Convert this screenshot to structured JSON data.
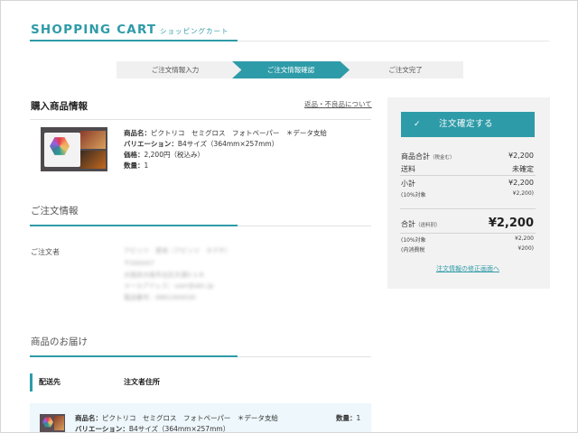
{
  "header": {
    "title": "SHOPPING CART",
    "subtitle": "ショッピングカート"
  },
  "steps": [
    "ご注文情報入力",
    "ご注文情報確認",
    "ご注文完了"
  ],
  "purchase": {
    "title": "購入商品情報",
    "returns_link": "返品・不良品について",
    "product": {
      "name_label": "商品名：",
      "name_value": "ピクトリコ　セミグロス　フォトペーパー　＊データ支給",
      "variation_label": "バリエーション：",
      "variation_value": "B4サイズ（364mm×257mm）",
      "price_label": "価格：",
      "price_value": "2,200円（税込み）",
      "qty_label": "数量：",
      "qty_value": "1"
    }
  },
  "order_info": {
    "title": "ご注文情報",
    "orderer_label": "ご注文者",
    "orderer_lines": [
      "アピッツ　恵地（アピッツ　オデヂ）",
      "〒000007",
      "大阪府大阪市北区天満5-1-6",
      "メールアドレス：user@abc.jp",
      "電話番号：0661000030"
    ]
  },
  "delivery": {
    "title": "商品のお届け",
    "dest_label": "配送先",
    "address_label": "注文者住所",
    "item": {
      "name_label": "商品名：",
      "name_value": "ピクトリコ　セミグロス　フォトペーパー　＊データ支給",
      "variation_label": "バリエーション：",
      "variation_value": "B4サイズ（364mm×257mm）",
      "qty_label": "数量：",
      "qty_value": "1"
    }
  },
  "summary": {
    "confirm_button": "注文確定する",
    "subtotal_label": "商品合計",
    "subtotal_note": "（税金む）",
    "subtotal_value": "¥2,200",
    "shipping_label": "送料",
    "shipping_value": "未確定",
    "small_total_label": "小計",
    "small_total_value": "¥2,200",
    "small_tax_label": "(10%対象",
    "small_tax_value": "¥2,200)",
    "total_label": "合計",
    "total_note": "（送料別）",
    "total_value": "¥2,200",
    "tax_label": "(10%対象",
    "tax_value": "¥2,200",
    "inner_tax_label": "(内消費税",
    "inner_tax_value": "¥200)",
    "edit_link": "注文情報の修正画面へ"
  },
  "colors": {
    "accent": "#2e9ba8",
    "panel": "#f2f2f2",
    "ship_box": "#eef7fb"
  }
}
